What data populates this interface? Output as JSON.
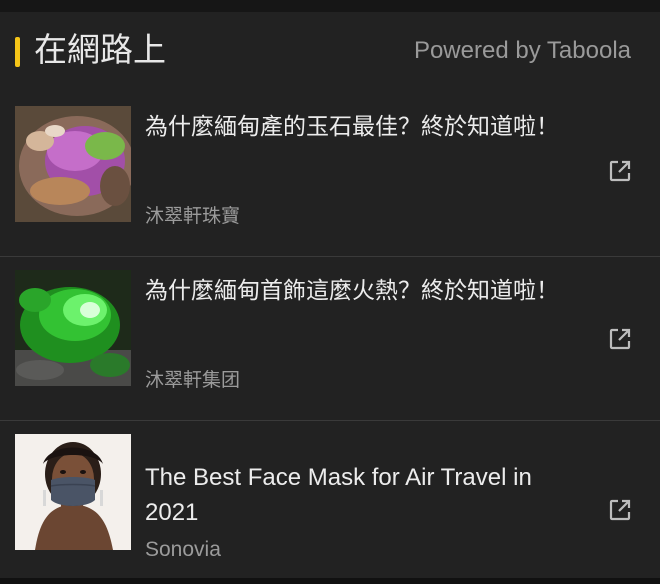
{
  "section": {
    "title": "在網路上",
    "powered_by": "Powered by Taboola",
    "accent_color": "#f5c518"
  },
  "items": [
    {
      "title": "為什麼緬甸產的玉石最佳？終於知道啦！",
      "source": "沐翠軒珠寶",
      "thumbnail": "purple-green-jade-stone",
      "action_icon": "external-link-icon"
    },
    {
      "title": "為什麼緬甸首飾這麼火熱？終於知道啦！",
      "source": "沐翠軒集团",
      "thumbnail": "glowing-green-jade",
      "action_icon": "external-link-icon"
    },
    {
      "title": "The Best Face Mask for Air Travel in 2021",
      "source": "Sonovia",
      "thumbnail": "woman-wearing-face-mask",
      "action_icon": "external-link-icon"
    }
  ]
}
